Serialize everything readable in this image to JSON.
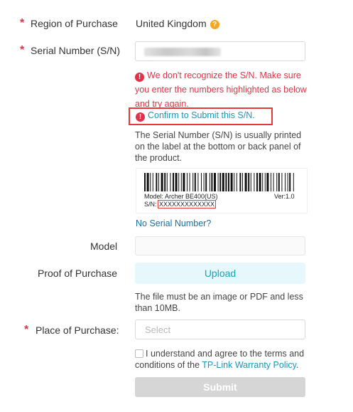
{
  "required_mark": "*",
  "region": {
    "label": "Region of Purchase",
    "value": "United Kingdom",
    "help_icon_glyph": "?"
  },
  "serial": {
    "label": "Serial Number (S/N)",
    "value_masked": "",
    "error_icon_glyph": "!",
    "error_lines": [
      "We don't recognize the S/N. Make sure",
      "you enter the numbers highlighted as below",
      "and try again."
    ],
    "confirm_link": "Confirm to Submit this S/N.",
    "hint_lines": [
      "The Serial Number (S/N) is usually printed",
      "on the label at the bottom or back panel of",
      "the product."
    ],
    "label_image": {
      "model_text": "Model: Archer BE400(US)",
      "version_text": "Ver:1.0",
      "sn_prefix": "S/N:",
      "sn_value": "XXXXXXXXXXXXX"
    },
    "no_serial_link": "No Serial Number?"
  },
  "model": {
    "label": "Model",
    "value": ""
  },
  "proof": {
    "label": "Proof of Purchase",
    "upload_label": "Upload",
    "hint_lines": [
      "The file must be an image or PDF and less",
      "than 10MB."
    ]
  },
  "place": {
    "label": "Place of Purchase:",
    "placeholder": "Select"
  },
  "agree": {
    "text_line1": "I understand and agree to the terms and",
    "text_line2_prefix": "conditions of the ",
    "policy_link": "TP-Link Warranty Policy",
    "text_line2_suffix": "."
  },
  "submit_label": "Submit",
  "colors": {
    "required": "#e0334a",
    "error": "#e0334a",
    "link": "#1a97b7",
    "upload_bg": "#e6f8fb",
    "submit_bg": "#d6d6d6",
    "highlight_border": "#e53935"
  }
}
